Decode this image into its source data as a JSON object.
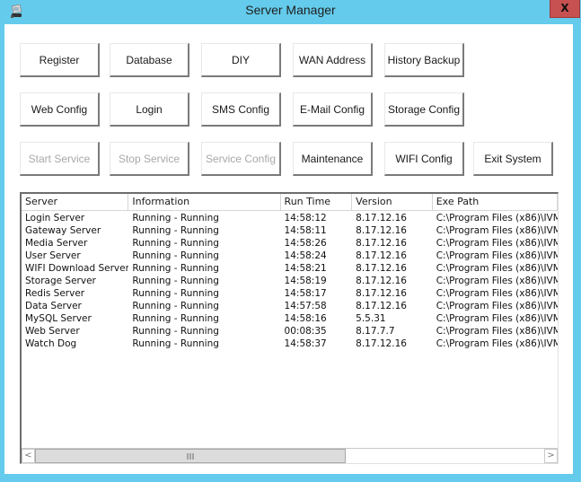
{
  "window": {
    "title": "Server Manager",
    "close_label": "X",
    "colors": {
      "frame": "#64cbec",
      "close": "#c75050"
    }
  },
  "buttons": [
    [
      {
        "label": "Register",
        "enabled": true
      },
      {
        "label": "Database",
        "enabled": true
      },
      {
        "label": "DIY",
        "enabled": true
      },
      {
        "label": "WAN Address",
        "enabled": true
      },
      {
        "label": "History Backup",
        "enabled": true
      }
    ],
    [
      {
        "label": "Web Config",
        "enabled": true
      },
      {
        "label": "Login",
        "enabled": true
      },
      {
        "label": "SMS Config",
        "enabled": true
      },
      {
        "label": "E-Mail Config",
        "enabled": true
      },
      {
        "label": "Storage Config",
        "enabled": true
      }
    ],
    [
      {
        "label": "Start Service",
        "enabled": false
      },
      {
        "label": "Stop Service",
        "enabled": false
      },
      {
        "label": "Service Config",
        "enabled": false
      },
      {
        "label": "Maintenance",
        "enabled": true
      },
      {
        "label": "WIFI Config",
        "enabled": true
      },
      {
        "label": "Exit System",
        "enabled": true
      }
    ]
  ],
  "table": {
    "columns": [
      "Server",
      "Information",
      "Run Time",
      "Version",
      "Exe Path"
    ],
    "rows": [
      [
        "Login Server",
        "Running - Running",
        "14:58:12",
        "8.17.12.16",
        "C:\\Program Files (x86)\\IVM"
      ],
      [
        "Gateway Server",
        "Running - Running",
        "14:58:11",
        "8.17.12.16",
        "C:\\Program Files (x86)\\IVM"
      ],
      [
        "Media Server",
        "Running - Running",
        "14:58:26",
        "8.17.12.16",
        "C:\\Program Files (x86)\\IVM"
      ],
      [
        "User Server",
        "Running - Running",
        "14:58:24",
        "8.17.12.16",
        "C:\\Program Files (x86)\\IVM"
      ],
      [
        "WIFI Download Server",
        "Running - Running",
        "14:58:21",
        "8.17.12.16",
        "C:\\Program Files (x86)\\IVM"
      ],
      [
        "Storage Server",
        "Running - Running",
        "14:58:19",
        "8.17.12.16",
        "C:\\Program Files (x86)\\IVM"
      ],
      [
        "Redis Server",
        "Running - Running",
        "14:58:17",
        "8.17.12.16",
        "C:\\Program Files (x86)\\IVM"
      ],
      [
        "Data Server",
        "Running - Running",
        "14:57:58",
        "8.17.12.16",
        "C:\\Program Files (x86)\\IVM"
      ],
      [
        "MySQL Server",
        "Running - Running",
        "14:58:16",
        "5.5.31",
        "C:\\Program Files (x86)\\IVM"
      ],
      [
        "Web Server",
        "Running - Running",
        "00:08:35",
        "8.17.7.7",
        "C:\\Program Files (x86)\\IVM"
      ],
      [
        "Watch Dog",
        "Running - Running",
        "14:58:37",
        "8.17.12.16",
        "C:\\Program Files (x86)\\IVM"
      ]
    ],
    "scrollbar": {
      "left_arrow": "<",
      "right_arrow": ">",
      "position_fraction": 0.0,
      "visible_fraction": 0.72
    }
  }
}
